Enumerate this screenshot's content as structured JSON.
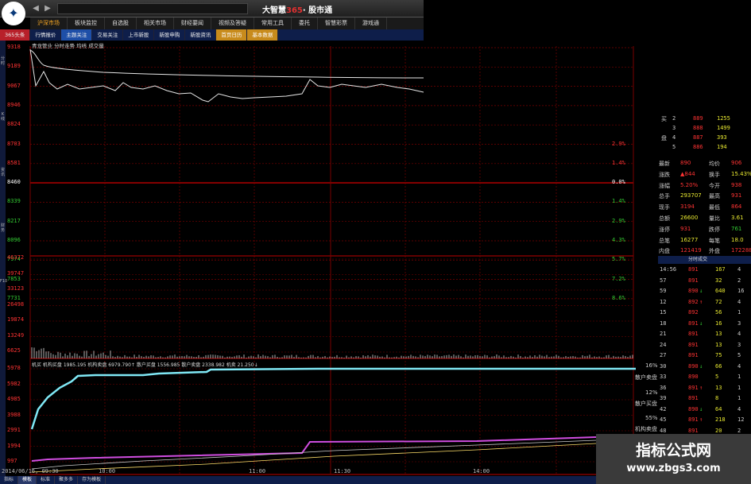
{
  "titlebar": {
    "logo_glyph": "✦",
    "brand_text": "大智慧",
    "brand_num": "365",
    "brand_suffix": "· 股市通"
  },
  "main_menu": [
    {
      "label": "沪深市场",
      "active": true
    },
    {
      "label": "板块监控",
      "active": false
    },
    {
      "label": "自选股",
      "active": false
    },
    {
      "label": "相关市场",
      "active": false
    },
    {
      "label": "财经要闻",
      "active": false
    },
    {
      "label": "视频及答疑",
      "active": false
    },
    {
      "label": "常用工具",
      "active": false
    },
    {
      "label": "委托",
      "active": false
    },
    {
      "label": "智慧彩票",
      "active": false
    },
    {
      "label": "游戏通",
      "active": false
    }
  ],
  "sub_menu": [
    {
      "label": "365头条",
      "style": "active"
    },
    {
      "label": "行情报价",
      "style": ""
    },
    {
      "label": "主题关注",
      "style": "blue"
    },
    {
      "label": "交易关注",
      "style": ""
    },
    {
      "label": "上市新股",
      "style": ""
    },
    {
      "label": "新股申购",
      "style": ""
    },
    {
      "label": "新股资讯",
      "style": ""
    },
    {
      "label": "首页日历",
      "style": "gold"
    },
    {
      "label": "基本数据",
      "style": "gold"
    }
  ],
  "stock_title": "青龙管业 分时走势 均线 成交量",
  "left_strip": [
    "分时",
    "K线",
    "资讯",
    "财务",
    "F10"
  ],
  "price_axis": [
    "9318",
    "9189",
    "9067",
    "8946",
    "8824",
    "8703",
    "8581",
    "8460",
    "8339",
    "8217",
    "8096",
    "7974",
    "7853",
    "7731"
  ],
  "pct_axis": [
    "2.9%",
    "1.4%",
    "0.0%",
    "1.4%",
    "2.9%",
    "4.3%",
    "5.7%",
    "7.2%",
    "8.6%"
  ],
  "vol_axis": [
    "46372",
    "39747",
    "33123",
    "26498",
    "19874",
    "13249",
    "6625"
  ],
  "lower_axis": [
    "5978",
    "5982",
    "4985",
    "3988",
    "2991",
    "1994",
    "997"
  ],
  "time_axis": [
    "2014/06/16, 09:30",
    "10:00",
    "11:00",
    "11:30",
    "14:00"
  ],
  "legend": "机买 机构买盘 1985.195 机构卖盘 6979.790↑ 散户买盘 1556.985 散户卖盘 2338.982 机卖 21.250↓",
  "order_book": [
    {
      "label": "买",
      "level": "2",
      "price": "889",
      "vol": "1255"
    },
    {
      "label": "",
      "level": "3",
      "price": "888",
      "vol": "1499"
    },
    {
      "label": "盘",
      "level": "4",
      "price": "887",
      "vol": "393"
    },
    {
      "label": "",
      "level": "5",
      "price": "886",
      "vol": "194"
    }
  ],
  "stats": [
    {
      "k1": "最新",
      "v1": "890",
      "k2": "均价",
      "v2": "906"
    },
    {
      "k1": "涨跌",
      "v1": "▲844",
      "k2": "换手",
      "v2": "15.43%"
    },
    {
      "k1": "涨幅",
      "v1": "5.20%",
      "k2": "今开",
      "v2": "938"
    },
    {
      "k1": "总手",
      "v1": "293707",
      "k2": "最高",
      "v2": "931"
    },
    {
      "k1": "现手",
      "v1": "3194",
      "k2": "最低",
      "v2": "864"
    },
    {
      "k1": "总额",
      "v1": "26600",
      "k2": "量比",
      "v2": "3.61"
    },
    {
      "k1": "涨停",
      "v1": "931",
      "k2": "跌停",
      "v2": "761"
    },
    {
      "k1": "总笔",
      "v1": "16277",
      "k2": "每笔",
      "v2": "18.0"
    },
    {
      "k1": "内盘",
      "v1": "121419",
      "k2": "外盘",
      "v2": "172288"
    }
  ],
  "tick_header": "分时成交",
  "ticks": [
    {
      "t": "14:56",
      "p": "891",
      "d": "",
      "v": "167",
      "n": "4"
    },
    {
      "t": "57",
      "p": "891",
      "d": "",
      "v": "32",
      "n": "2"
    },
    {
      "t": "59",
      "p": "890",
      "d": "↓",
      "v": "640",
      "n": "16"
    },
    {
      "t": "12",
      "p": "892",
      "d": "↑",
      "v": "72",
      "n": "4"
    },
    {
      "t": "15",
      "p": "892",
      "d": "",
      "v": "56",
      "n": "1"
    },
    {
      "t": "18",
      "p": "891",
      "d": "↓",
      "v": "16",
      "n": "3"
    },
    {
      "t": "21",
      "p": "891",
      "d": "",
      "v": "13",
      "n": "4"
    },
    {
      "t": "24",
      "p": "891",
      "d": "",
      "v": "13",
      "n": "3"
    },
    {
      "t": "27",
      "p": "891",
      "d": "",
      "v": "75",
      "n": "5"
    },
    {
      "t": "30",
      "p": "890",
      "d": "↓",
      "v": "66",
      "n": "4"
    },
    {
      "t": "33",
      "p": "890",
      "d": "",
      "v": "5",
      "n": "1"
    },
    {
      "t": "36",
      "p": "891",
      "d": "↑",
      "v": "13",
      "n": "1"
    },
    {
      "t": "39",
      "p": "891",
      "d": "",
      "v": "8",
      "n": "1"
    },
    {
      "t": "42",
      "p": "890",
      "d": "↓",
      "v": "64",
      "n": "4"
    },
    {
      "t": "45",
      "p": "891",
      "d": "↑",
      "v": "218",
      "n": "12"
    },
    {
      "t": "48",
      "p": "891",
      "d": "",
      "v": "20",
      "n": "2"
    }
  ],
  "right_labels": [
    {
      "text": "16%"
    },
    {
      "text": "散户卖盘"
    },
    {
      "text": "12%"
    },
    {
      "text": "散户买盘"
    },
    {
      "text": "55%"
    },
    {
      "text": "机构卖盘"
    }
  ],
  "bottom_tabs": [
    {
      "label": "指标",
      "active": false
    },
    {
      "label": "模板",
      "active": true
    },
    {
      "label": "标准",
      "active": false
    },
    {
      "label": "聚多多",
      "active": false
    },
    {
      "label": "存为模板",
      "active": false
    }
  ],
  "watermark": {
    "title": "指标公式网",
    "url": "www.zbgs3.com"
  },
  "colors": {
    "up": "#ff3333",
    "down": "#33cc33",
    "flat": "#ffffff",
    "grid": "#7a0000",
    "cyan": "#7fe8f5",
    "magenta": "#d04de0",
    "yellow": "#e8e830"
  }
}
